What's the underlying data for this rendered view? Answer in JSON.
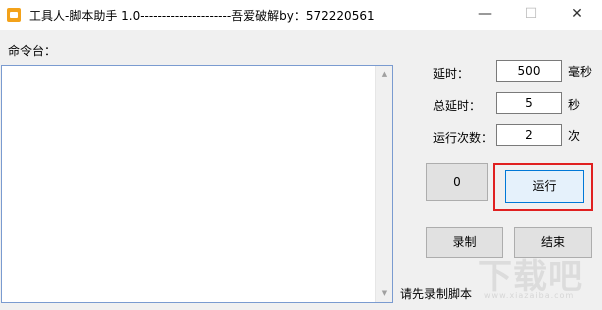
{
  "window": {
    "title": "工具人-脚本助手 1.0---------------------吾爱破解by：572220561",
    "minimize_glyph": "—",
    "maximize_glyph": "☐",
    "close_glyph": "✕"
  },
  "console": {
    "label": "命令台：",
    "content": "",
    "scroll_up_glyph": "▲",
    "scroll_down_glyph": "▼"
  },
  "settings": {
    "delay": {
      "label": "延时：",
      "value": "500",
      "unit": "毫秒"
    },
    "total_delay": {
      "label": "总延时：",
      "value": "5",
      "unit": "秒"
    },
    "run_count": {
      "label": "运行次数：",
      "value": "2",
      "unit": "次"
    }
  },
  "buttons": {
    "counter": "0",
    "run": "运行",
    "record": "录制",
    "end": "结束"
  },
  "status": {
    "text": "请先录制脚本"
  },
  "watermark": {
    "text": "下载吧",
    "sub": "www.xiazaiba.com"
  },
  "colors": {
    "highlight": "#e02020",
    "accent": "#0078d7",
    "app_icon": "#f3a21a"
  }
}
